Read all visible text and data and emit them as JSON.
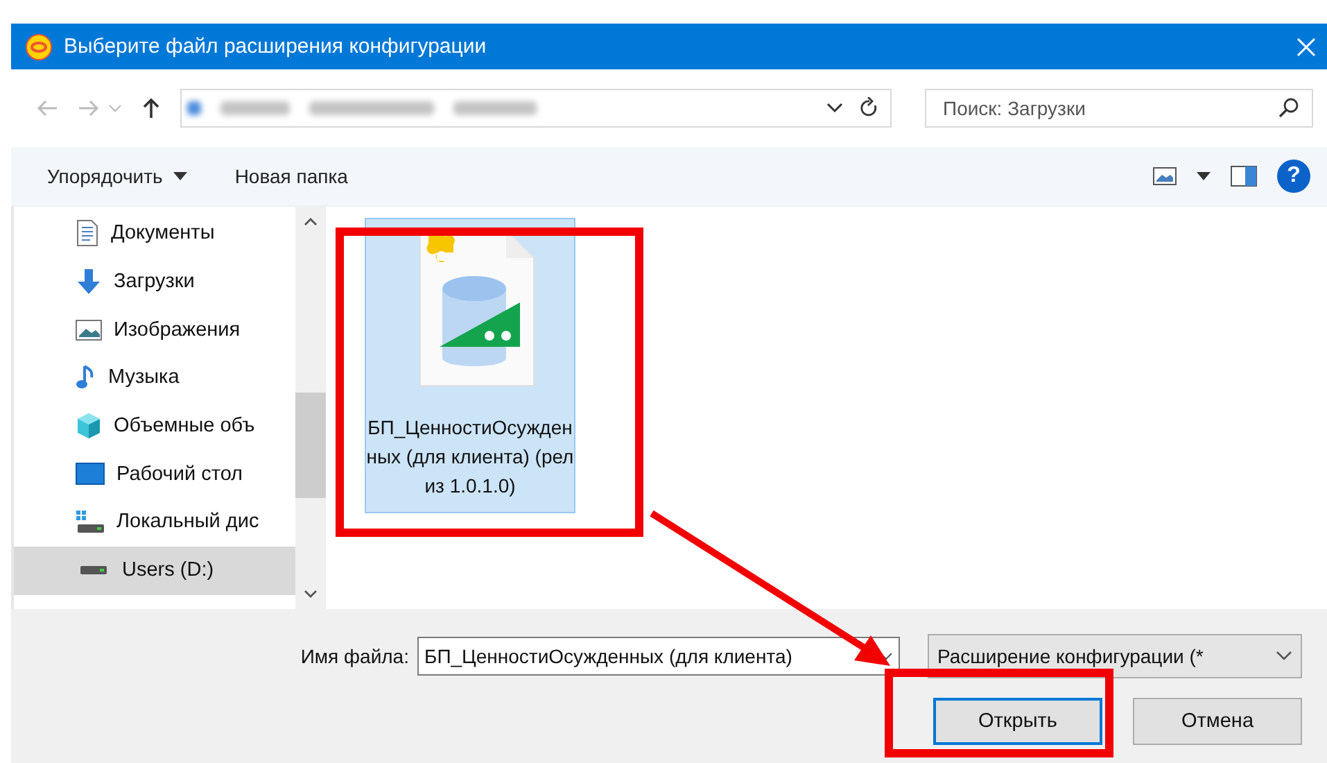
{
  "window": {
    "title": "Выберите файл расширения конфигурации"
  },
  "search": {
    "placeholder": "Поиск: Загрузки"
  },
  "toolbar": {
    "organize": "Упорядочить",
    "new_folder": "Новая папка",
    "help": "?"
  },
  "sidebar": {
    "items": [
      {
        "label": "Документы",
        "kind": "documents",
        "selected": false
      },
      {
        "label": "Загрузки",
        "kind": "downloads",
        "selected": false
      },
      {
        "label": "Изображения",
        "kind": "pictures",
        "selected": false
      },
      {
        "label": "Музыка",
        "kind": "music",
        "selected": false
      },
      {
        "label": "Объемные объ",
        "kind": "objects3d",
        "selected": false
      },
      {
        "label": "Рабочий стол",
        "kind": "desktop",
        "selected": false
      },
      {
        "label": "Локальный дис",
        "kind": "localdisk",
        "selected": false
      },
      {
        "label": "Users (D:)",
        "kind": "drive",
        "selected": true
      }
    ]
  },
  "files": [
    {
      "name": "БП_ЦенностиОсужденных (для клиента) (релиз 1.0.1.0)",
      "selected": true
    }
  ],
  "footer": {
    "filename_label": "Имя файла:",
    "filename": "БП_ЦенностиОсужденных (для клиента)",
    "filter": "Расширение конфигурации (*",
    "open": "Открыть",
    "cancel": "Отмена"
  }
}
